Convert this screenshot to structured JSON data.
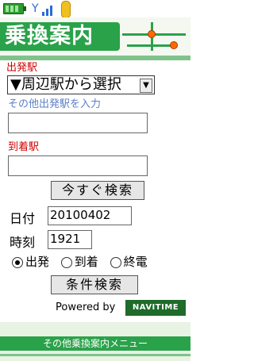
{
  "header": {
    "title": "乗換案内"
  },
  "form": {
    "departure_label": "出発駅",
    "departure_select": "▼周辺駅から選択",
    "other_departure_label": "その他出発駅を入力",
    "other_departure_value": "",
    "arrival_label": "到着駅",
    "arrival_value": "",
    "search_now_label": "今すぐ検索",
    "date_label": "日付",
    "date_value": "20100402",
    "time_label": "時刻",
    "time_value": "1921",
    "options": [
      {
        "label": "出発",
        "checked": true
      },
      {
        "label": "到着",
        "checked": false
      },
      {
        "label": "終電",
        "checked": false
      }
    ],
    "condition_search_label": "条件検索"
  },
  "powered_by": "Powered by",
  "logo": "NAVITIME",
  "footer": {
    "label": "その他乗換案内メニュー"
  },
  "colors": {
    "brand_green": "#2aa24a",
    "label_red": "#d40000",
    "label_blue": "#5b7fc7"
  }
}
